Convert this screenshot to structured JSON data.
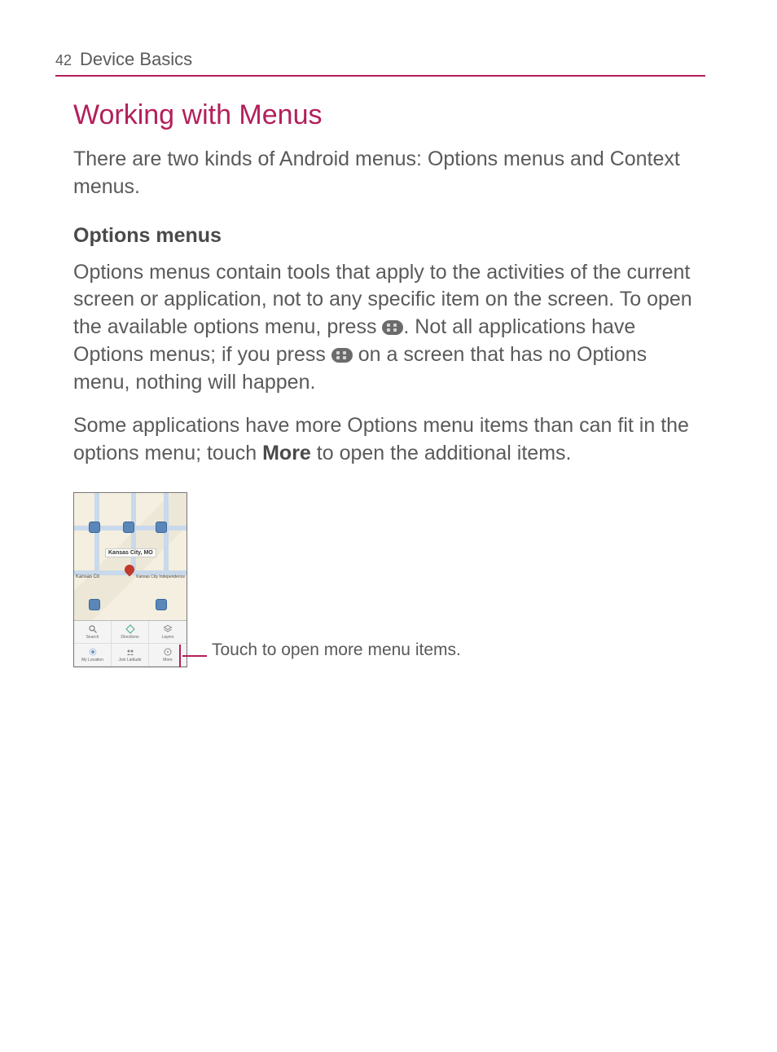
{
  "header": {
    "page_number": "42",
    "section": "Device Basics"
  },
  "title": "Working with Menus",
  "intro": "There are two kinds of Android menus: Options menus and Context menus.",
  "options": {
    "heading": "Options menus",
    "p1a": "Options menus contain tools that apply to the activities of the current screen or application, not to any specific item on the screen. To open the available options menu, press ",
    "p1b": ". Not all applications have Options menus; if you press ",
    "p1c": " on a screen that has no Options menu, nothing will happen.",
    "p2a": "Some applications have more Options menu items than can fit in the options menu; touch ",
    "more": "More",
    "p2b": " to open the additional items."
  },
  "figure": {
    "city_label": "Kansas City, MO",
    "side_left": "Kansas Cit",
    "side_right": "Kansas City Independence",
    "menu_items": [
      "Search",
      "Directions",
      "Layers",
      "My Location",
      "Join Latitude",
      "More"
    ],
    "callout": "Touch to open more menu items."
  }
}
